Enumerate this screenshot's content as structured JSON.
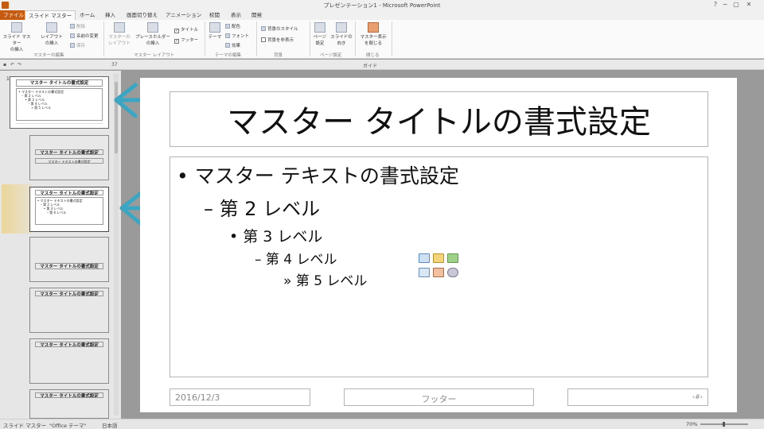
{
  "window": {
    "title": "プレゼンテーション1 - Microsoft PowerPoint",
    "controls": [
      "?",
      "−",
      "▢",
      "✕"
    ]
  },
  "tabs": [
    {
      "label": "ファイル",
      "kind": "file"
    },
    {
      "label": "スライド マスター",
      "kind": "active"
    },
    {
      "label": "ホーム",
      "kind": ""
    },
    {
      "label": "挿入",
      "kind": ""
    },
    {
      "label": "画面切り替え",
      "kind": ""
    },
    {
      "label": "アニメーション",
      "kind": ""
    },
    {
      "label": "校閲",
      "kind": ""
    },
    {
      "label": "表示",
      "kind": ""
    },
    {
      "label": "開発",
      "kind": ""
    }
  ],
  "ribbon": {
    "insert_master": "スライド マスター\nの挿入",
    "insert_layout": "レイアウト\nの挿入",
    "delete": "削除",
    "rename": "名前の変更",
    "preserve": "保存",
    "master_layout": "マスターの\nレイアウト",
    "insert_placeholder": "プレースホルダー\nの挿入",
    "title_check": "タイトル",
    "footer_check": "フッター",
    "theme": "テーマ",
    "colors": "配色",
    "fonts": "フォント",
    "effects": "効果",
    "bg_styles": "背景のスタイル",
    "hide_bg": "背景を非表示",
    "page_setup": "ページ\n設定",
    "orientation": "スライドの\n向き",
    "close_master": "マスター表示\nを閉じる",
    "group_master_edit": "マスターの編集",
    "group_master_layout": "マスター レイアウト",
    "group_theme_edit": "テーマの編集",
    "group_background": "背景",
    "group_page_setup": "ページ設定",
    "group_close": "閉じる"
  },
  "toolbar2": {
    "font_size": "37",
    "guides": "ガイド"
  },
  "thumbnails": {
    "slide_number": "1",
    "master_title": "マスター タイトルの書式設定",
    "master_text": "• マスター テキストの書式設定",
    "level2": "– 第 2 レベル",
    "level3": "• 第 3 レベル",
    "level4": "– 第 4 レベル",
    "level5": "» 第 5 レベル",
    "sub_text": "マスター テキストの書式設定"
  },
  "slide": {
    "title": "マスター タイトルの書式設定",
    "body": [
      "• マスター テキストの書式設定",
      "– 第 2 レベル",
      "• 第 3 レベル",
      "– 第 4 レベル",
      "» 第 5 レベル"
    ],
    "date": "2016/12/3",
    "footer": "フッター",
    "page_number": "‹#›"
  },
  "status": {
    "view": "スライド マスター",
    "theme": "\"Office テーマ\"",
    "language": "日本語",
    "zoom": "70%"
  },
  "colors": {
    "accent_file": "#c55a11",
    "arrow": "#3aa6c4"
  }
}
